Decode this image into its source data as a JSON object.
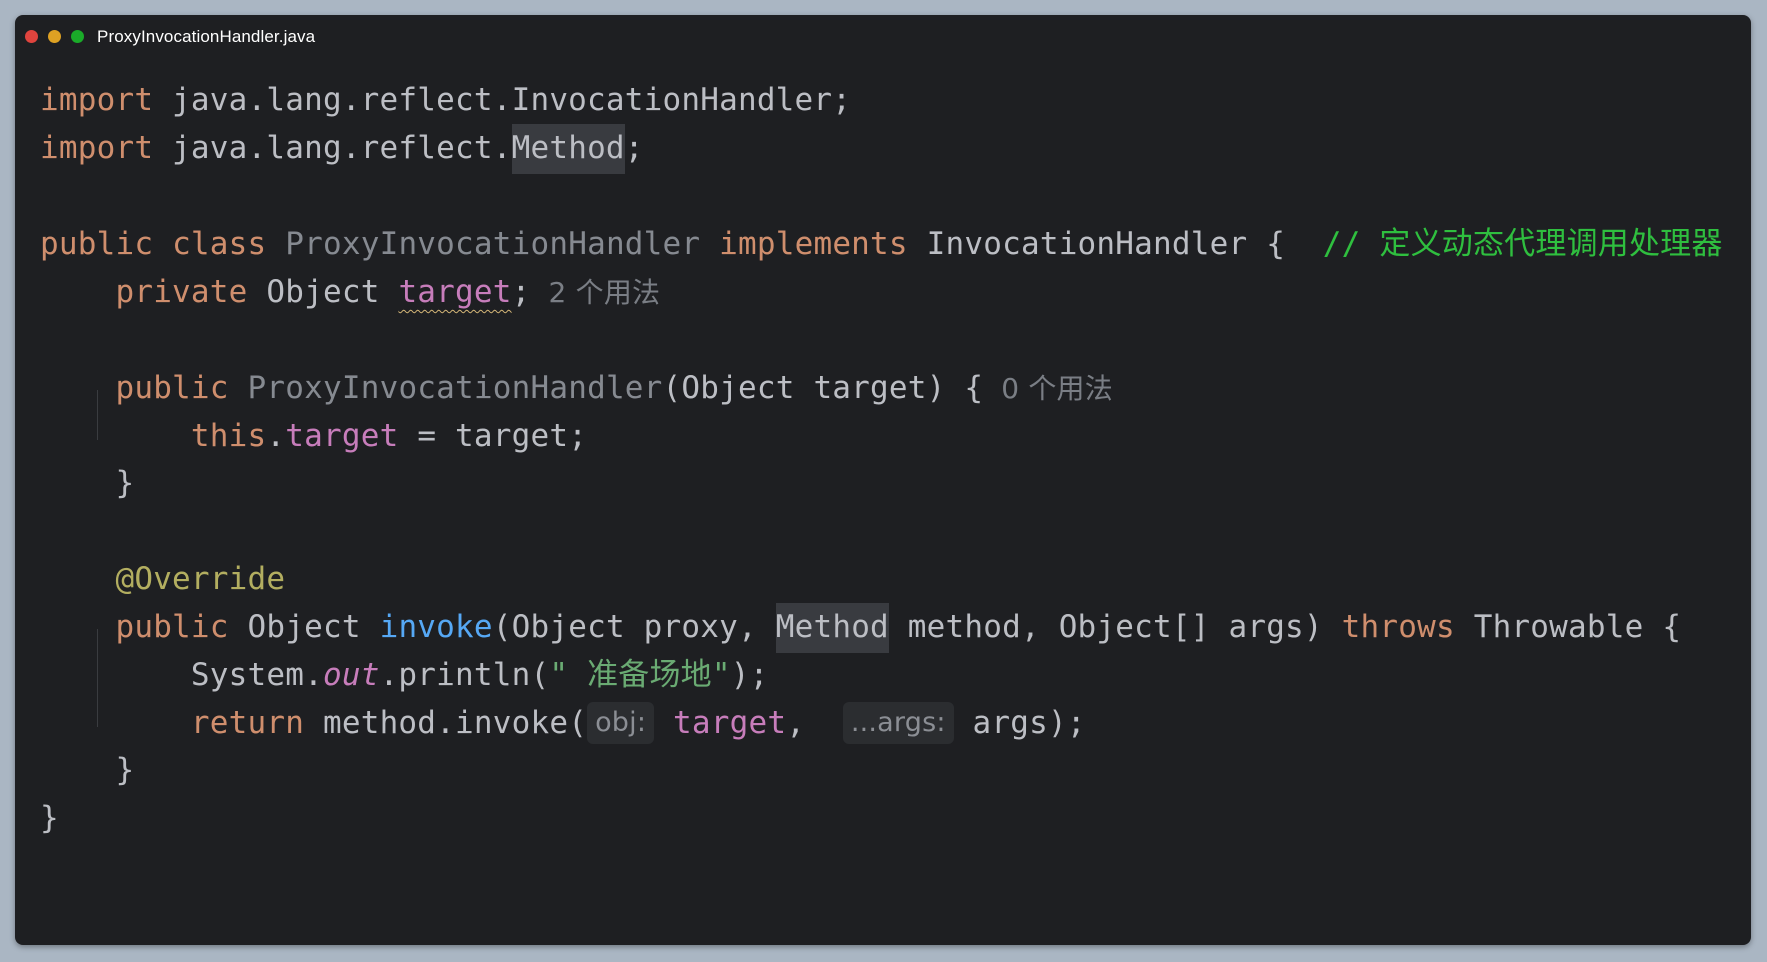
{
  "window": {
    "title": "ProxyInvocationHandler.java"
  },
  "code": {
    "l1": {
      "kw": "import",
      "rest": " java.lang.reflect.InvocationHandler;"
    },
    "l2": {
      "kw": "import",
      "rest": " java.lang.reflect.",
      "hl": "Method",
      "end": ";"
    },
    "l4": {
      "kw1": "public",
      "kw2": "class",
      "cls": "ProxyInvocationHandler",
      "kw3": "implements",
      "iface": " InvocationHandler {  ",
      "comment": "// 定义动态代理调用处理器"
    },
    "l5": {
      "kw": "private",
      "type": " Object ",
      "field": "target",
      "semi": ";",
      "usage": "2 个用法"
    },
    "l7": {
      "kw": "public",
      "ctor": "ProxyInvocationHandler",
      "params": "(Object target) {",
      "usage": "0 个用法"
    },
    "l8": {
      "kw": "this",
      "dot": ".",
      "field": "target",
      "rest": " = target;"
    },
    "l9": {
      "brace": "}"
    },
    "l11": {
      "ann": "@Override"
    },
    "l12": {
      "kw": "public",
      "ret": " Object ",
      "fn": "invoke",
      "p1": "(Object proxy, ",
      "hl": "Method",
      "p2": " method, Object[] args) ",
      "kw2": "throws",
      "rest": " Throwable {"
    },
    "l13": {
      "pre": "System.",
      "out": "out",
      "mid": ".println(",
      "str": "\" 准备场地\"",
      "end": ");"
    },
    "l14": {
      "kw": "return",
      "mid": " method.invoke(",
      "hint1": "obj:",
      "field": "target",
      "comma": ", ",
      "hint2": "...args:",
      "end": " args);"
    },
    "l15": {
      "brace": "}"
    },
    "l16": {
      "brace": "}"
    }
  },
  "colors": {
    "background": "#1e1f22",
    "keyword": "#cf8e6d",
    "function": "#56a8f5",
    "field": "#c77dbb",
    "annotation": "#b3ae60",
    "string": "#6aab73",
    "comment": "#2fbf3f"
  }
}
